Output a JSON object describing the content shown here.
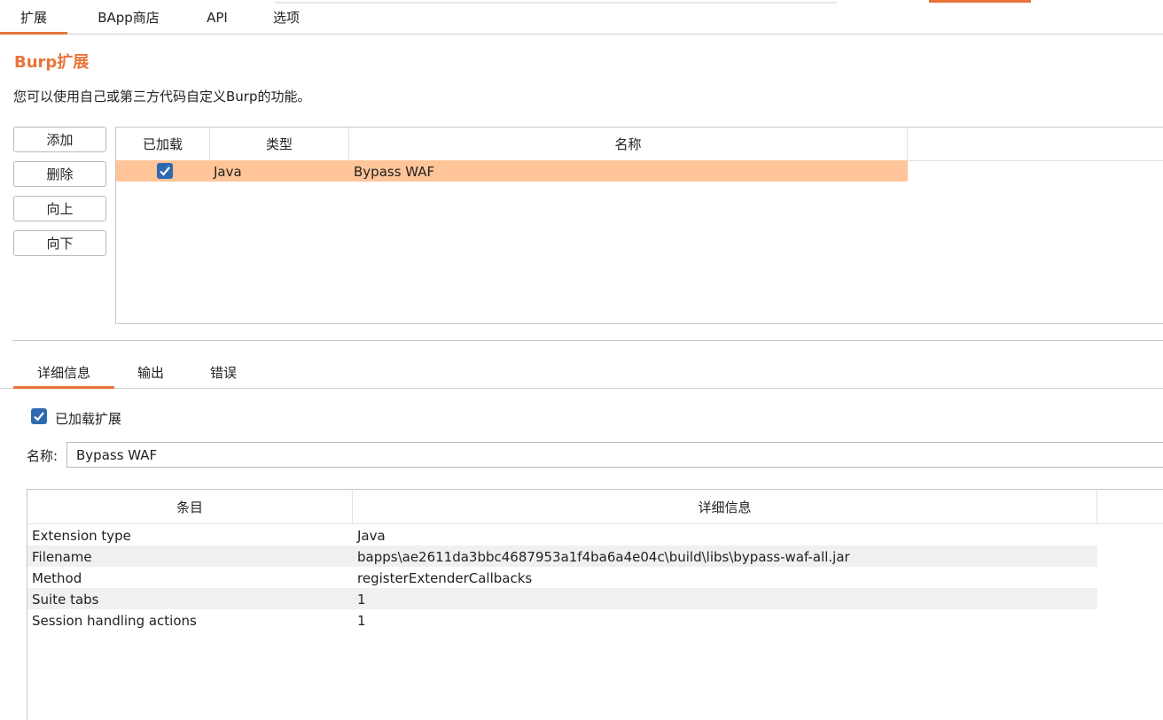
{
  "top_tabs": [
    "扩展",
    "BApp商店",
    "API",
    "选项"
  ],
  "title": "Burp扩展",
  "description": "您可以使用自己或第三方代码自定义Burp的功能。",
  "buttons": {
    "add": "添加",
    "remove": "删除",
    "up": "向上",
    "down": "向下"
  },
  "ext_table": {
    "headers": [
      "已加载",
      "类型",
      "名称"
    ],
    "rows": [
      {
        "loaded": true,
        "type": "Java",
        "name": "Bypass WAF"
      }
    ]
  },
  "sub_tabs": [
    "详细信息",
    "输出",
    "错误"
  ],
  "details": {
    "loaded_label": "已加载扩展",
    "name_label": "名称:",
    "name_value": "Bypass WAF"
  },
  "detail_table": {
    "headers": [
      "条目",
      "详细信息"
    ],
    "rows": [
      {
        "item": "Extension type",
        "value": "Java"
      },
      {
        "item": "Filename",
        "value": "bapps\\ae2611da3bbc4687953a1f4ba6a4e04c\\build\\libs\\bypass-waf-all.jar"
      },
      {
        "item": "Method",
        "value": "registerExtenderCallbacks"
      },
      {
        "item": "Suite tabs",
        "value": "1"
      },
      {
        "item": "Session handling actions",
        "value": "1"
      }
    ]
  },
  "colors": {
    "accent": "#e8743b",
    "selected_row": "#ffc599",
    "checkbox": "#2e6ab0"
  }
}
